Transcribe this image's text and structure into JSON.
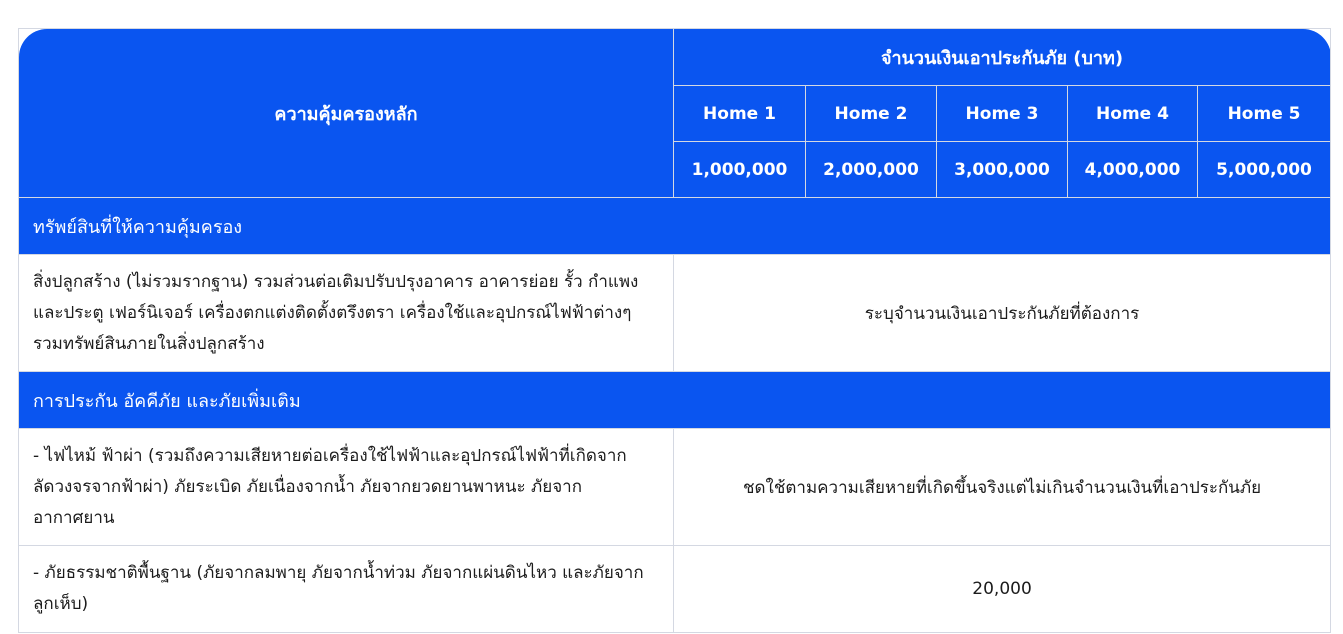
{
  "header": {
    "main_coverage": "ความคุ้มครองหลัก",
    "sum_insured": "จำนวนเงินเอาประกันภัย (บาท)",
    "plans": [
      {
        "name": "Home 1",
        "amount": "1,000,000"
      },
      {
        "name": "Home 2",
        "amount": "2,000,000"
      },
      {
        "name": "Home 3",
        "amount": "3,000,000"
      },
      {
        "name": "Home 4",
        "amount": "4,000,000"
      },
      {
        "name": "Home 5",
        "amount": "5,000,000"
      }
    ]
  },
  "sections": [
    {
      "title": "ทรัพย์สินที่ให้ความคุ้มครอง",
      "rows": [
        {
          "description": "สิ่งปลูกสร้าง (ไม่รวมรากฐาน) รวมส่วนต่อเติมปรับปรุงอาคาร อาคารย่อย รั้ว กำแพง และประตู เฟอร์นิเจอร์ เครื่องตกแต่งติดตั้งตรึงตรา เครื่องใช้และอุปกรณ์ไฟฟ้าต่างๆ รวมทรัพย์สินภายในสิ่งปลูกสร้าง",
          "value": "ระบุจำนวนเงินเอาประกันภัยที่ต้องการ"
        }
      ]
    },
    {
      "title": "การประกัน อัคคีภัย และภัยเพิ่มเติม",
      "rows": [
        {
          "description": "- ไฟไหม้ ฟ้าผ่า (รวมถึงความเสียหายต่อเครื่องใช้ไฟฟ้าและอุปกรณ์ไฟฟ้าที่เกิดจากลัดวงจรจากฟ้าผ่า) ภัยระเบิด ภัยเนื่องจากน้ำ ภัยจากยวดยานพาหนะ ภัยจากอากาศยาน",
          "value": "ชดใช้ตามความเสียหายที่เกิดขึ้นจริงแต่ไม่เกินจำนวนเงินที่เอาประกันภัย"
        },
        {
          "description": "- ภัยธรรมชาติพื้นฐาน (ภัยจากลมพายุ ภัยจากน้ำท่วม ภัยจากแผ่นดินไหว และภัยจากลูกเห็บ)",
          "value": "20,000"
        }
      ]
    }
  ],
  "colors": {
    "header_blue": "#0a55f0",
    "border": "#d4d8e2",
    "text": "#1c1c1c"
  }
}
